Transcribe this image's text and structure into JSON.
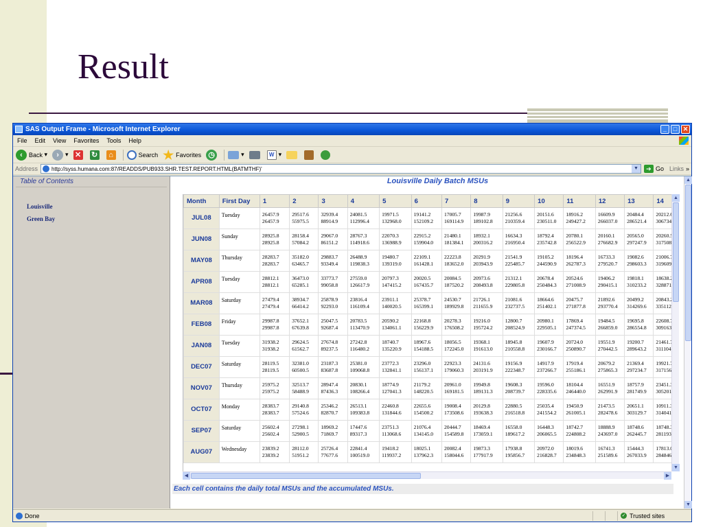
{
  "slide": {
    "title": "Result"
  },
  "window": {
    "title": "SAS Output Frame - Microsoft Internet Explorer",
    "menu": [
      "File",
      "Edit",
      "View",
      "Favorites",
      "Tools",
      "Help"
    ],
    "toolbar": {
      "back": "Back",
      "search": "Search",
      "favorites": "Favorites"
    },
    "address": {
      "label": "Address",
      "url": "http://syss.humana.com:87/READDS/PUB933.SHR.TEST.REPORT.HTML(BATMTHF)'",
      "go": "Go",
      "links": "Links"
    },
    "status": {
      "text": "Done",
      "zone": "Trusted sites"
    }
  },
  "toc": {
    "title": "Table of Contents",
    "items": [
      "Louisville",
      "Green Bay"
    ]
  },
  "report": {
    "title": "Louisville Daily Batch MSUs",
    "footnote": "Each cell contains the daily total MSUs and the accumulated MSUs.",
    "columns": [
      "Month",
      "First Day",
      "1",
      "2",
      "3",
      "4",
      "5",
      "6",
      "7",
      "8",
      "9",
      "10",
      "11",
      "12",
      "13",
      "14"
    ],
    "rows": [
      {
        "month": "JUL08",
        "first_day": "Tuesday",
        "cells": [
          [
            "26457.9",
            "26457.9"
          ],
          [
            "29517.6",
            "55975.5"
          ],
          [
            "32939.4",
            "88914.9"
          ],
          [
            "24081.5",
            "112996.4"
          ],
          [
            "19971.5",
            "132968.0"
          ],
          [
            "19141.2",
            "152109.2"
          ],
          [
            "17005.7",
            "169114.9"
          ],
          [
            "19987.9",
            "189102.8"
          ],
          [
            "21256.6",
            "210359.4"
          ],
          [
            "20151.6",
            "230511.0"
          ],
          [
            "18916.2",
            "249427.2"
          ],
          [
            "16609.9",
            "266037.0"
          ],
          [
            "20484.4",
            "286521.4"
          ],
          [
            "20212.6",
            "306734."
          ]
        ]
      },
      {
        "month": "JUN08",
        "first_day": "Sunday",
        "cells": [
          [
            "28925.8",
            "28925.8"
          ],
          [
            "28158.4",
            "57084.2"
          ],
          [
            "29067.0",
            "86151.2"
          ],
          [
            "28767.3",
            "114918.6"
          ],
          [
            "22070.3",
            "136988.9"
          ],
          [
            "22915.2",
            "159904.0"
          ],
          [
            "21480.1",
            "181384.1"
          ],
          [
            "18932.1",
            "200316.2"
          ],
          [
            "16634.3",
            "216950.4"
          ],
          [
            "18792.4",
            "235742.8"
          ],
          [
            "20780.1",
            "256522.9"
          ],
          [
            "20160.1",
            "276682.9"
          ],
          [
            "20565.0",
            "297247.9"
          ],
          [
            "20260.5",
            "317508."
          ]
        ]
      },
      {
        "month": "MAY08",
        "first_day": "Thursday",
        "cells": [
          [
            "28283.7",
            "28283.7"
          ],
          [
            "35182.0",
            "63465.7"
          ],
          [
            "29883.7",
            "93349.4"
          ],
          [
            "26488.9",
            "119838.3"
          ],
          [
            "19480.7",
            "139319.0"
          ],
          [
            "22109.1",
            "161428.1"
          ],
          [
            "22223.8",
            "183652.0"
          ],
          [
            "20291.9",
            "203943.9"
          ],
          [
            "21541.9",
            "225485.7"
          ],
          [
            "19105.2",
            "244590.9"
          ],
          [
            "18196.4",
            "262787.3"
          ],
          [
            "16733.3",
            "279520.7"
          ],
          [
            "19082.6",
            "298603.3"
          ],
          [
            "21006.7",
            "319609."
          ]
        ]
      },
      {
        "month": "APR08",
        "first_day": "Tuesday",
        "cells": [
          [
            "28812.1",
            "28812.1"
          ],
          [
            "36473.0",
            "65285.1"
          ],
          [
            "33773.7",
            "99058.8"
          ],
          [
            "27559.0",
            "126617.9"
          ],
          [
            "20797.3",
            "147415.2"
          ],
          [
            "20020.5",
            "167435.7"
          ],
          [
            "20084.5",
            "187520.2"
          ],
          [
            "20973.6",
            "208493.8"
          ],
          [
            "21312.1",
            "229805.8"
          ],
          [
            "20678.4",
            "250484.3"
          ],
          [
            "20524.6",
            "271008.9"
          ],
          [
            "19406.2",
            "290415.1"
          ],
          [
            "19818.1",
            "310233.2"
          ],
          [
            "18638.2",
            "328871."
          ]
        ]
      },
      {
        "month": "MAR08",
        "first_day": "Saturday",
        "cells": [
          [
            "27479.4",
            "27479.4"
          ],
          [
            "38934.7",
            "66414.2"
          ],
          [
            "25878.9",
            "92293.0"
          ],
          [
            "23816.4",
            "116109.4"
          ],
          [
            "23911.1",
            "140020.5"
          ],
          [
            "25378.7",
            "165399.1"
          ],
          [
            "24530.7",
            "189929.8"
          ],
          [
            "21726.1",
            "211655.9"
          ],
          [
            "21081.6",
            "232737.5"
          ],
          [
            "18664.6",
            "251402.1"
          ],
          [
            "20475.7",
            "271877.8"
          ],
          [
            "21892.6",
            "293770.4"
          ],
          [
            "20499.2",
            "314269.6"
          ],
          [
            "20843.2",
            "335112."
          ]
        ]
      },
      {
        "month": "FEB08",
        "first_day": "Friday",
        "cells": [
          [
            "29987.8",
            "29987.8"
          ],
          [
            "37652.1",
            "67639.8"
          ],
          [
            "25047.5",
            "92687.4"
          ],
          [
            "20783.5",
            "113470.9"
          ],
          [
            "20590.2",
            "134061.1"
          ],
          [
            "22168.8",
            "156229.9"
          ],
          [
            "20278.3",
            "176508.2"
          ],
          [
            "19216.0",
            "195724.2"
          ],
          [
            "12800.7",
            "208524.9"
          ],
          [
            "20980.1",
            "229505.1"
          ],
          [
            "17869.4",
            "247374.5"
          ],
          [
            "19484.5",
            "266859.0"
          ],
          [
            "19695.8",
            "286554.8"
          ],
          [
            "22608.7",
            "309163."
          ]
        ]
      },
      {
        "month": "JAN08",
        "first_day": "Tuesday",
        "cells": [
          [
            "31938.2",
            "31938.2"
          ],
          [
            "29624.5",
            "61562.7"
          ],
          [
            "27674.8",
            "89237.5"
          ],
          [
            "27242.8",
            "116480.2"
          ],
          [
            "18740.7",
            "135220.9"
          ],
          [
            "18967.6",
            "154188.5"
          ],
          [
            "18056.5",
            "172245.0"
          ],
          [
            "19368.1",
            "191613.0"
          ],
          [
            "18945.8",
            "210558.8"
          ],
          [
            "19607.9",
            "230166.7"
          ],
          [
            "20724.0",
            "250890.7"
          ],
          [
            "19551.9",
            "270442.5"
          ],
          [
            "19200.7",
            "289643.2"
          ],
          [
            "21461.7",
            "311104."
          ]
        ]
      },
      {
        "month": "DEC07",
        "first_day": "Saturday",
        "cells": [
          [
            "28119.5",
            "28119.5"
          ],
          [
            "32381.0",
            "60500.5"
          ],
          [
            "23187.3",
            "83687.8"
          ],
          [
            "25381.0",
            "109068.8"
          ],
          [
            "23772.3",
            "132841.1"
          ],
          [
            "23296.0",
            "156137.1"
          ],
          [
            "22923.3",
            "179060.3"
          ],
          [
            "24131.6",
            "203191.9"
          ],
          [
            "19156.9",
            "222348.7"
          ],
          [
            "14917.9",
            "237266.7"
          ],
          [
            "17919.4",
            "255186.1"
          ],
          [
            "20679.2",
            "275865.3"
          ],
          [
            "21369.4",
            "297234.7"
          ],
          [
            "19921.7",
            "317156."
          ]
        ]
      },
      {
        "month": "NOV07",
        "first_day": "Thursday",
        "cells": [
          [
            "25975.2",
            "25975.2"
          ],
          [
            "32513.7",
            "58488.9"
          ],
          [
            "28947.4",
            "87436.3"
          ],
          [
            "20830.1",
            "108266.4"
          ],
          [
            "18774.9",
            "127041.3"
          ],
          [
            "21179.2",
            "148220.5"
          ],
          [
            "20961.0",
            "169181.5"
          ],
          [
            "19949.8",
            "189131.3"
          ],
          [
            "19608.3",
            "208739.7"
          ],
          [
            "19596.0",
            "228335.6"
          ],
          [
            "18104.4",
            "246440.0"
          ],
          [
            "16551.9",
            "262991.9"
          ],
          [
            "18757.9",
            "281749.9"
          ],
          [
            "23451.3",
            "305201."
          ]
        ]
      },
      {
        "month": "OCT07",
        "first_day": "Monday",
        "cells": [
          [
            "28383.7",
            "28383.7"
          ],
          [
            "29140.8",
            "57524.6"
          ],
          [
            "25346.2",
            "82870.7"
          ],
          [
            "26513.1",
            "109383.8"
          ],
          [
            "22460.8",
            "131844.6"
          ],
          [
            "22655.6",
            "154500.2"
          ],
          [
            "19008.4",
            "173508.6"
          ],
          [
            "20129.8",
            "193638.3"
          ],
          [
            "22880.5",
            "216518.8"
          ],
          [
            "25035.4",
            "241554.2"
          ],
          [
            "19450.9",
            "261005.1"
          ],
          [
            "21473.5",
            "282478.6"
          ],
          [
            "20651.1",
            "303129.7"
          ],
          [
            "10911.3",
            "314041."
          ]
        ]
      },
      {
        "month": "SEP07",
        "first_day": "Saturday",
        "cells": [
          [
            "25602.4",
            "25602.4"
          ],
          [
            "27298.1",
            "52900.5"
          ],
          [
            "18969.2",
            "71869.7"
          ],
          [
            "17447.6",
            "89317.3"
          ],
          [
            "23751.3",
            "113068.6"
          ],
          [
            "21076.4",
            "134145.0"
          ],
          [
            "20444.7",
            "154589.8"
          ],
          [
            "18469.4",
            "173059.1"
          ],
          [
            "16558.0",
            "189617.2"
          ],
          [
            "16448.3",
            "206065.5"
          ],
          [
            "18742.7",
            "224808.2"
          ],
          [
            "18888.9",
            "243697.0"
          ],
          [
            "18748.6",
            "262445.7"
          ],
          [
            "18748.3",
            "281193."
          ]
        ]
      },
      {
        "month": "AUG07",
        "first_day": "Wednesday",
        "cells": [
          [
            "23839.2",
            "23839.2"
          ],
          [
            "28112.0",
            "51951.2"
          ],
          [
            "25726.4",
            "77677.6"
          ],
          [
            "22841.4",
            "100519.0"
          ],
          [
            "19418.2",
            "119937.2"
          ],
          [
            "18025.1",
            "137962.3"
          ],
          [
            "20082.4",
            "158044.6"
          ],
          [
            "19873.3",
            "177917.9"
          ],
          [
            "17938.8",
            "195856.7"
          ],
          [
            "20972.0",
            "216828.7"
          ],
          [
            "18019.6",
            "234848.3"
          ],
          [
            "16741.3",
            "251589.6"
          ],
          [
            "15444.3",
            "267033.9"
          ],
          [
            "17813.0",
            "284846."
          ]
        ]
      }
    ]
  }
}
